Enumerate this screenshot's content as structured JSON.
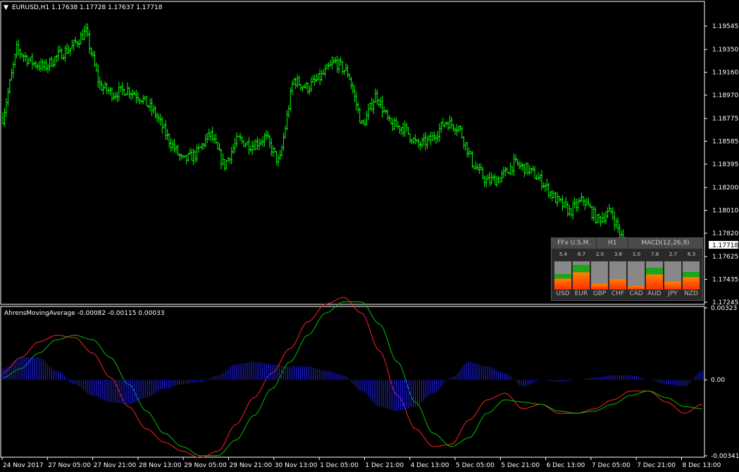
{
  "main_header": {
    "arrow": "▼",
    "text": "EURUSD,H1  1.17638 1.17728 1.17637 1.17718"
  },
  "indicator_header": {
    "text": "AhrensMovingAverage -0.00082 -0.00115 0.00033"
  },
  "current_price_label": "1.17718",
  "colors": {
    "candle": "#00ff00",
    "red_line": "#ff2020",
    "green_line": "#00c000",
    "histogram": "#2020ff",
    "axis": "#ffffff"
  },
  "chart_data": [
    {
      "type": "candlestick",
      "symbol": "EURUSD",
      "timeframe": "H1",
      "ylim": [
        1.17245,
        1.19545
      ],
      "yticks": [
        "1.19545",
        "1.19350",
        "1.19160",
        "1.18970",
        "1.18775",
        "1.18585",
        "1.18395",
        "1.18200",
        "1.18010",
        "1.17820",
        "1.17625",
        "1.17435",
        "1.17245"
      ],
      "close_path": [
        [
          0,
          1.1878
        ],
        [
          1,
          1.1935
        ],
        [
          2,
          1.1925
        ],
        [
          3,
          1.192
        ],
        [
          4,
          1.193
        ],
        [
          5,
          1.1937
        ],
        [
          6,
          1.195
        ],
        [
          7,
          1.1905
        ],
        [
          8,
          1.1898
        ],
        [
          9,
          1.1902
        ],
        [
          10,
          1.1895
        ],
        [
          11,
          1.1882
        ],
        [
          12,
          1.186
        ],
        [
          13,
          1.1842
        ],
        [
          14,
          1.1848
        ],
        [
          15,
          1.1865
        ],
        [
          16,
          1.1838
        ],
        [
          17,
          1.186
        ],
        [
          18,
          1.1855
        ],
        [
          19,
          1.1862
        ],
        [
          20,
          1.184
        ],
        [
          21,
          1.191
        ],
        [
          22,
          1.1903
        ],
        [
          23,
          1.1912
        ],
        [
          24,
          1.1925
        ],
        [
          25,
          1.1915
        ],
        [
          26,
          1.187
        ],
        [
          27,
          1.1898
        ],
        [
          28,
          1.1872
        ],
        [
          29,
          1.187
        ],
        [
          30,
          1.1855
        ],
        [
          31,
          1.186
        ],
        [
          32,
          1.1875
        ],
        [
          33,
          1.187
        ],
        [
          34,
          1.184
        ],
        [
          35,
          1.1825
        ],
        [
          36,
          1.1828
        ],
        [
          37,
          1.184
        ],
        [
          38,
          1.1835
        ],
        [
          39,
          1.1825
        ],
        [
          40,
          1.181
        ],
        [
          41,
          1.18
        ],
        [
          42,
          1.181
        ],
        [
          43,
          1.1793
        ],
        [
          44,
          1.18
        ],
        [
          45,
          1.17718
        ]
      ],
      "y_axis_values": [
        1.19545,
        1.1935,
        1.1916,
        1.1897,
        1.18775,
        1.18585,
        1.18395,
        1.182,
        1.1801,
        1.1782,
        1.17625,
        1.17435,
        1.17245
      ]
    },
    {
      "type": "line",
      "title": "AhrensMovingAverage",
      "ylim": [
        -0.00341,
        0.00323
      ],
      "yticks": [
        "0.00323",
        "0.00",
        "-0.00341"
      ],
      "series": [
        {
          "color": "#ff2020",
          "values": [
            0.0003,
            0.001,
            0.0017,
            0.002,
            0.0019,
            0.0012,
            0.0001,
            -0.0012,
            -0.0022,
            -0.0028,
            -0.0032,
            -0.0035,
            -0.0032,
            -0.002,
            -0.0008,
            0.0003,
            0.0014,
            0.0026,
            0.0034,
            0.0037,
            0.003,
            0.0013,
            -0.0007,
            -0.0022,
            -0.003,
            -0.0029,
            -0.0018,
            -0.0009,
            -0.0006,
            -0.0013,
            -0.0011,
            -0.0015,
            -0.0015,
            -0.0013,
            -0.0009,
            -0.0005,
            -0.0005,
            -0.001,
            -0.0015,
            -0.0011
          ]
        },
        {
          "color": "#00c000",
          "values": [
            0.0001,
            0.0005,
            0.0012,
            0.0018,
            0.002,
            0.0018,
            0.001,
            -0.0002,
            -0.0014,
            -0.0024,
            -0.003,
            -0.0034,
            -0.0034,
            -0.0027,
            -0.0016,
            -0.0004,
            0.0008,
            0.002,
            0.003,
            0.0035,
            0.0035,
            0.0025,
            0.0008,
            -0.001,
            -0.0024,
            -0.003,
            -0.0026,
            -0.0015,
            -0.0009,
            -0.001,
            -0.0011,
            -0.0014,
            -0.0015,
            -0.0014,
            -0.0011,
            -0.0007,
            -0.0005,
            -0.0008,
            -0.0012,
            -0.0013
          ]
        },
        {
          "color": "#2020ff",
          "style": "histogram",
          "values": [
            0.0005,
            0.001,
            0.001,
            0.0004,
            -0.0002,
            -0.0007,
            -0.001,
            -0.0011,
            -0.0008,
            -0.0004,
            -0.0002,
            -0.0001,
            0.0002,
            0.0007,
            0.0008,
            0.0007,
            0.0006,
            0.0006,
            0.0004,
            0.0002,
            -0.0005,
            -0.0012,
            -0.0014,
            -0.0012,
            -0.0006,
            0.0001,
            0.0008,
            0.0006,
            0.0003,
            -0.0003,
            0.0,
            -0.0001,
            0.0,
            0.0001,
            0.0002,
            0.0002,
            0.0,
            -0.0002,
            -0.0003,
            0.0004
          ]
        }
      ]
    }
  ],
  "x_labels": [
    "24 Nov 2017",
    "27 Nov 05:00",
    "27 Nov 21:00",
    "28 Nov 13:00",
    "29 Nov 05:00",
    "29 Nov 21:00",
    "30 Nov 13:00",
    "1 Dec 05:00",
    "1 Dec 21:00",
    "4 Dec 13:00",
    "5 Dec 05:00",
    "5 Dec 21:00",
    "6 Dec 13:00",
    "7 Dec 05:00",
    "7 Dec 21:00",
    "8 Dec 13:00"
  ],
  "panel": {
    "headers": [
      "FFx U.S.M.",
      "H1",
      "MACD(12,26,9)"
    ],
    "currencies": [
      {
        "name": "USD",
        "value": "5.4",
        "level": 0.54
      },
      {
        "name": "EUR",
        "value": "8.7",
        "level": 0.87
      },
      {
        "name": "GBP",
        "value": "2.0",
        "level": 0.2
      },
      {
        "name": "CHF",
        "value": "3.8",
        "level": 0.38
      },
      {
        "name": "CAD",
        "value": "1.0",
        "level": 0.1
      },
      {
        "name": "AUD",
        "value": "7.8",
        "level": 0.78
      },
      {
        "name": "JPY",
        "value": "2.7",
        "level": 0.27
      },
      {
        "name": "NZD",
        "value": "6.3",
        "level": 0.63
      }
    ]
  }
}
